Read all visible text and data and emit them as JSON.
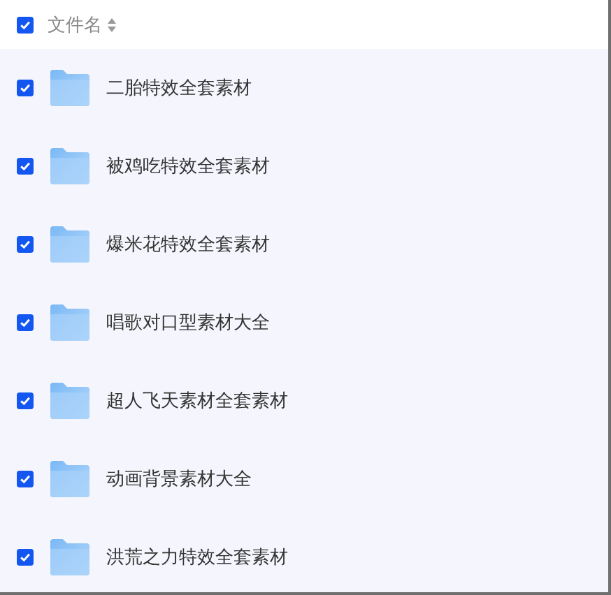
{
  "header": {
    "checked": true,
    "column": "文件名"
  },
  "files": [
    {
      "name": "二胎特效全套素材",
      "checked": true
    },
    {
      "name": "被鸡吃特效全套素材",
      "checked": true
    },
    {
      "name": "爆米花特效全套素材",
      "checked": true
    },
    {
      "name": "唱歌对口型素材大全",
      "checked": true
    },
    {
      "name": "超人飞天素材全套素材",
      "checked": true
    },
    {
      "name": "动画背景素材大全",
      "checked": true
    },
    {
      "name": "洪荒之力特效全套素材",
      "checked": true
    }
  ]
}
